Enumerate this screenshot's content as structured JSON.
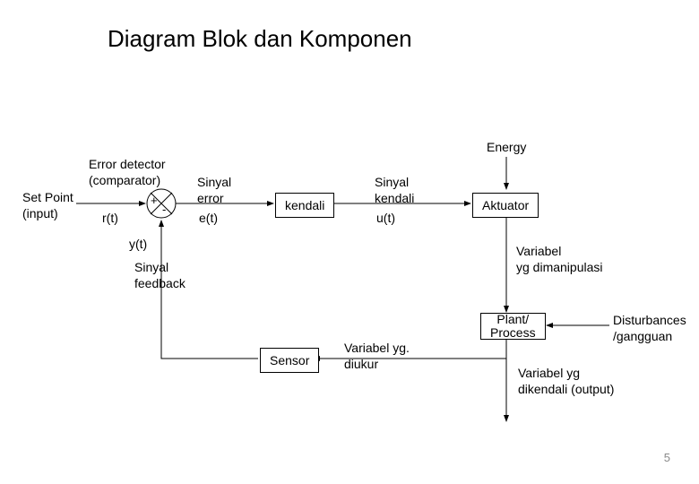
{
  "title": "Diagram Blok dan Komponen",
  "labels": {
    "error_detector": "Error detector\n(comparator)",
    "set_point": "Set Point\n(input)",
    "sinyal_error": "Sinyal\nerror",
    "kendali": "kendali",
    "sinyal_kendali": "Sinyal\nkendali",
    "energy": "Energy",
    "aktuator": "Aktuator",
    "rt": "r(t)",
    "et": "e(t)",
    "ut": "u(t)",
    "yt": "y(t)",
    "sinyal_feedback": "Sinyal\nfeedback",
    "plant": "Plant/\nProcess",
    "disturbances": "Disturbances\n/gangguan",
    "var_manip": "Variabel\nyg dimanipulasi",
    "var_diukur": "Variabel yg.\ndiukur",
    "var_output": "Variabel yg\ndikendali (output)",
    "sensor": "Sensor",
    "plus": "+",
    "minus": "-"
  },
  "slide_no": "5"
}
